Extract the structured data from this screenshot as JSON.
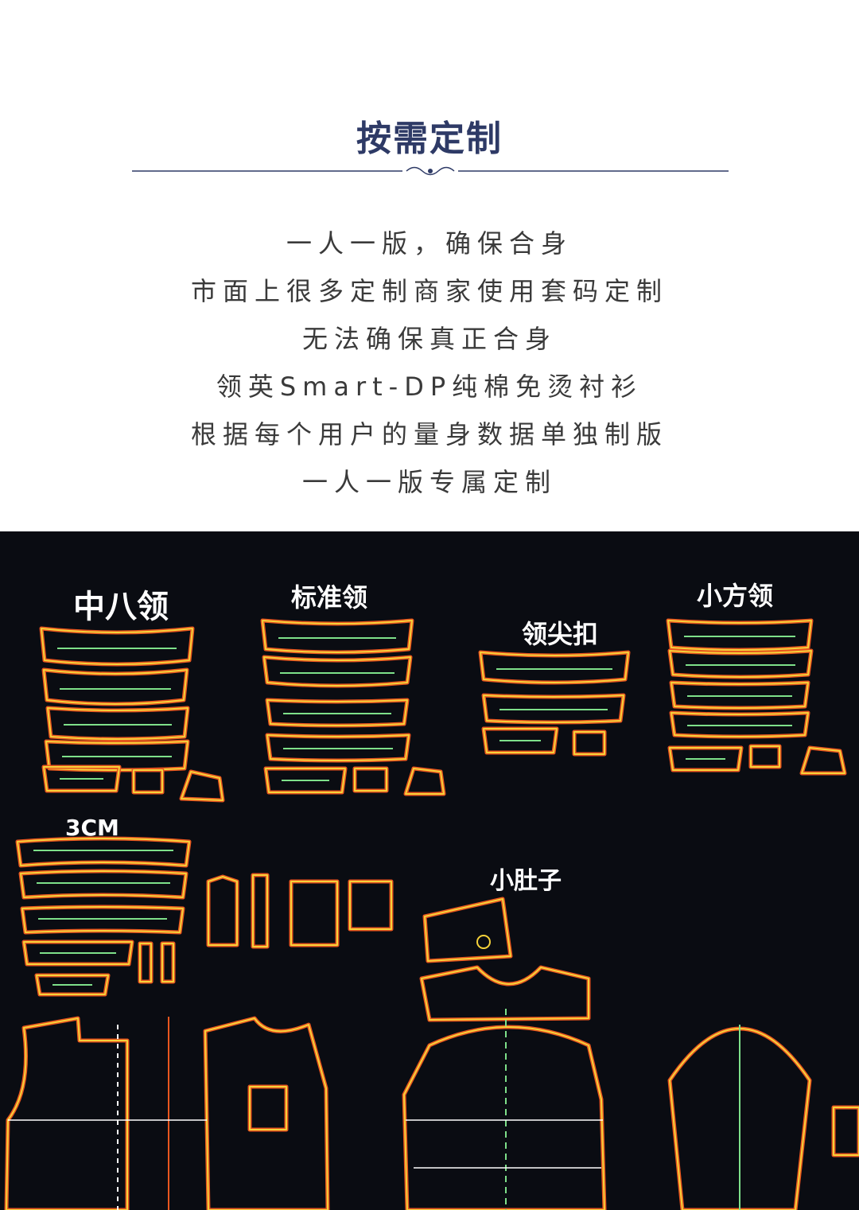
{
  "header": {
    "title": "按需定制"
  },
  "intro_lines": [
    "一人一版，确保合身",
    "市面上很多定制商家使用套码定制",
    "无法确保真正合身",
    "领英Smart-DP纯棉免烫衬衫",
    "根据每个用户的量身数据单独制版",
    "一人一版专属定制"
  ],
  "pattern_board": {
    "labels": {
      "collar_zhongba": "中八领",
      "collar_standard": "标准领",
      "collar_pointed_button": "领尖扣",
      "collar_small_square": "小方领",
      "cuff_3cm": "3CM",
      "belly": "小肚子"
    },
    "colors": {
      "background": "#0a0c12",
      "outline_outer": "#e8561f",
      "outline_inner": "#f5d23a",
      "guide": "#7ee08a",
      "dash": "#ffffff"
    }
  },
  "colors": {
    "title": "#2e3a66",
    "text": "#3a3a3a"
  }
}
